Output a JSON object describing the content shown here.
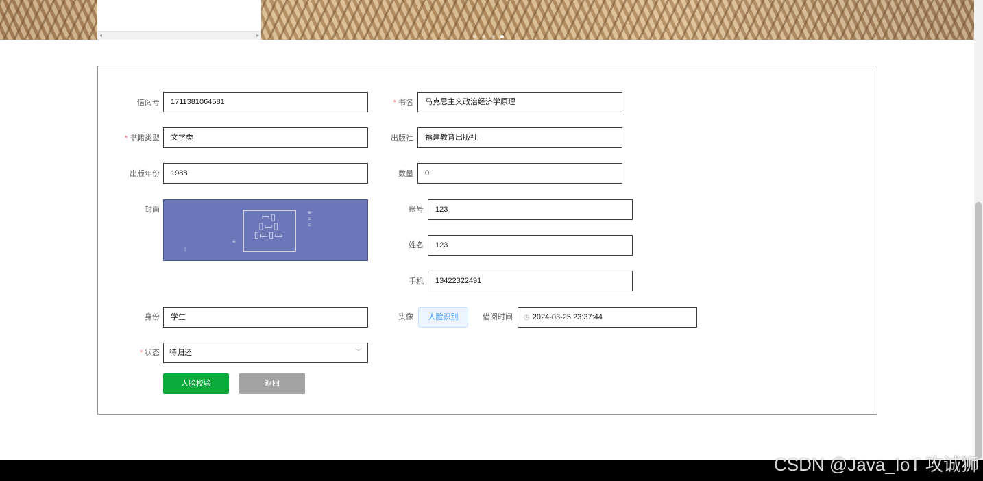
{
  "form": {
    "borrow_no": {
      "label": "借阅号",
      "value": "1711381064581"
    },
    "book_name": {
      "label": "书名",
      "value": "马克思主义政治经济学原理"
    },
    "book_type": {
      "label": "书籍类型",
      "value": "文学类"
    },
    "publisher": {
      "label": "出版社",
      "value": "福建教育出版社"
    },
    "publish_year": {
      "label": "出版年份",
      "value": "1988"
    },
    "quantity": {
      "label": "数量",
      "value": "0"
    },
    "cover": {
      "label": "封面"
    },
    "account": {
      "label": "账号",
      "value": "123"
    },
    "name": {
      "label": "姓名",
      "value": "123"
    },
    "phone": {
      "label": "手机",
      "value": "13422322491"
    },
    "identity": {
      "label": "身份",
      "value": "学生"
    },
    "avatar": {
      "label": "头像",
      "button": "人脸识别"
    },
    "borrow_time": {
      "label": "借阅时间",
      "value": "2024-03-25 23:37:44"
    },
    "status": {
      "label": "状态",
      "value": "待归还"
    }
  },
  "actions": {
    "face_verify": "人脸校验",
    "back": "返回"
  },
  "icons": {
    "clock": "clock-icon",
    "chevron": "chevron-down-icon"
  },
  "colors": {
    "required": "#f56c6c",
    "primary_green": "#0aab3a",
    "back_gray": "#a3a3a3",
    "face_button_text": "#409eff"
  },
  "watermark": "CSDN @Java_IoT 攻诚狮"
}
